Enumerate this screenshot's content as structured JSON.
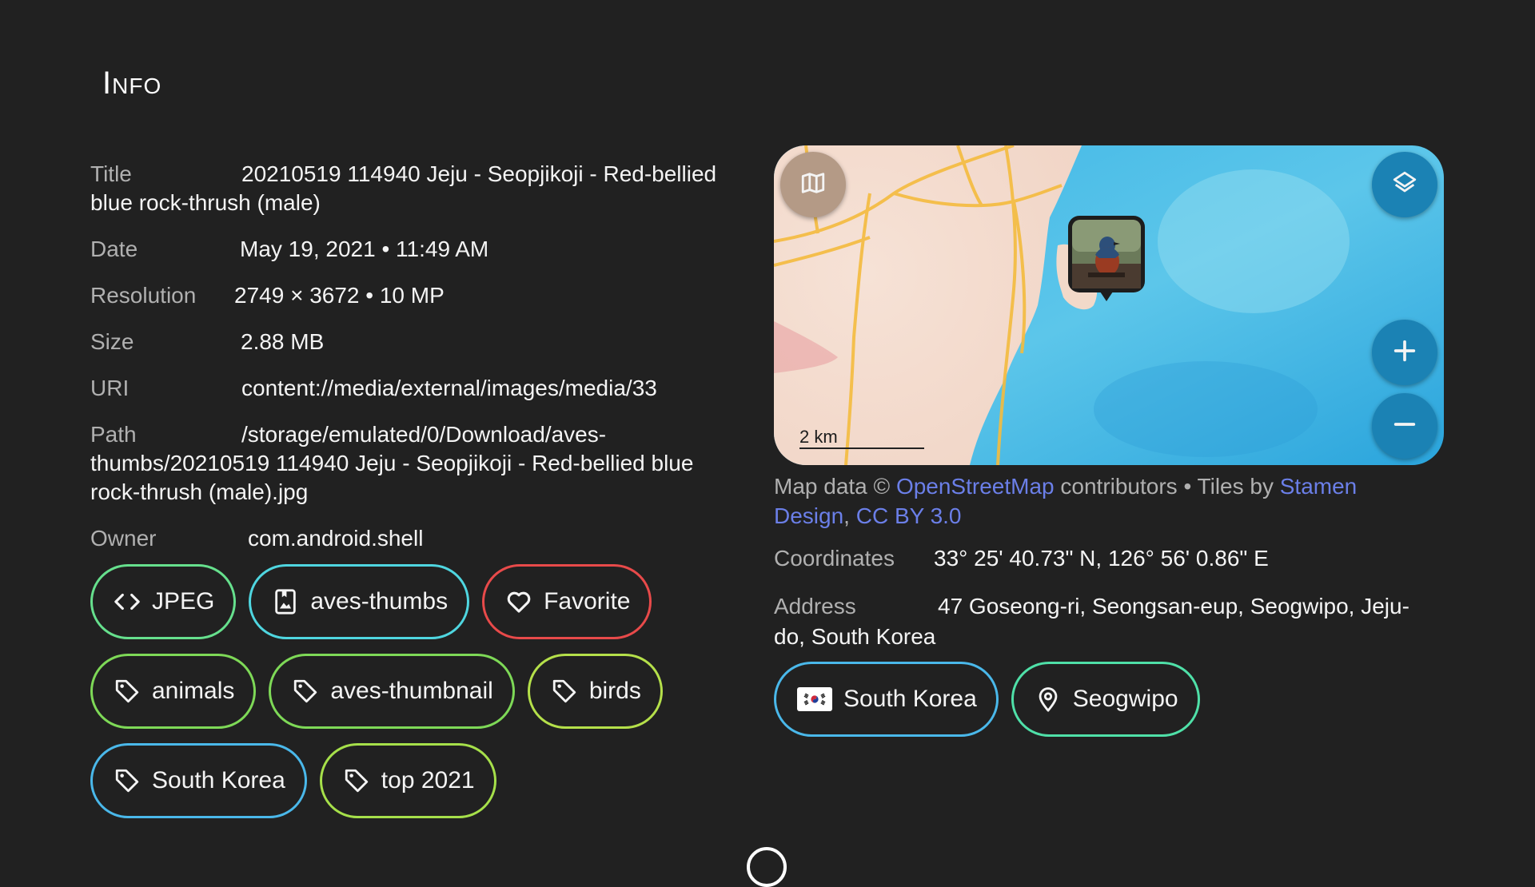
{
  "page": {
    "title": "Info"
  },
  "info": {
    "title_label": "Title",
    "title_value": "20210519 114940 Jeju - Seopjikoji - Red-bellied blue rock-thrush (male)",
    "date_label": "Date",
    "date_value": "May 19, 2021 • 11:49 AM",
    "resolution_label": "Resolution",
    "resolution_value": "2749 × 3672 • 10 MP",
    "size_label": "Size",
    "size_value": "2.88 MB",
    "uri_label": "URI",
    "uri_value": "content://media/external/images/media/33",
    "path_label": "Path",
    "path_value": "/storage/emulated/0/Download/aves-thumbs/20210519 114940 Jeju - Seopjikoji - Red-bellied blue rock-thrush (male).jpg",
    "owner_label": "Owner",
    "owner_value": "com.android.shell"
  },
  "chips": [
    {
      "label": "JPEG",
      "icon": "code-icon",
      "color": "#66e08d"
    },
    {
      "label": "aves-thumbs",
      "icon": "album-icon",
      "color": "#4fd6e0"
    },
    {
      "label": "Favorite",
      "icon": "heart-icon",
      "color": "#e84a4a"
    },
    {
      "label": "animals",
      "icon": "tag-icon",
      "color": "#7ed957"
    },
    {
      "label": "aves-thumbnail",
      "icon": "tag-icon",
      "color": "#7ed957"
    },
    {
      "label": "birds",
      "icon": "tag-icon",
      "color": "#b5e04a"
    },
    {
      "label": "South Korea",
      "icon": "tag-icon",
      "color": "#4ab8ea"
    },
    {
      "label": "top 2021",
      "icon": "tag-icon",
      "color": "#a6e04a"
    }
  ],
  "map": {
    "scale_label": "2 km",
    "buttons": [
      "map-style-icon",
      "layers-icon",
      "zoom-in-icon",
      "zoom-out-icon"
    ]
  },
  "attribution": {
    "prefix": "Map data © ",
    "osm_link": "OpenStreetMap",
    "middle": " contributors • Tiles by ",
    "stamen_link": "Stamen Design",
    "separator": ", ",
    "license_link": "CC BY 3.0"
  },
  "location": {
    "coordinates_label": "Coordinates",
    "coordinates_value": "33° 25' 40.73\" N, 126° 56' 0.86\" E",
    "address_label": "Address",
    "address_value": "47 Goseong-ri, Seongsan-eup, Seogwipo, Jeju-do, South Korea"
  },
  "location_chips": [
    {
      "label": "South Korea",
      "icon": "south-korea-flag-icon",
      "color": "#4ab8ea"
    },
    {
      "label": "Seogwipo",
      "icon": "place-pin-icon",
      "color": "#4fe0a8"
    }
  ]
}
